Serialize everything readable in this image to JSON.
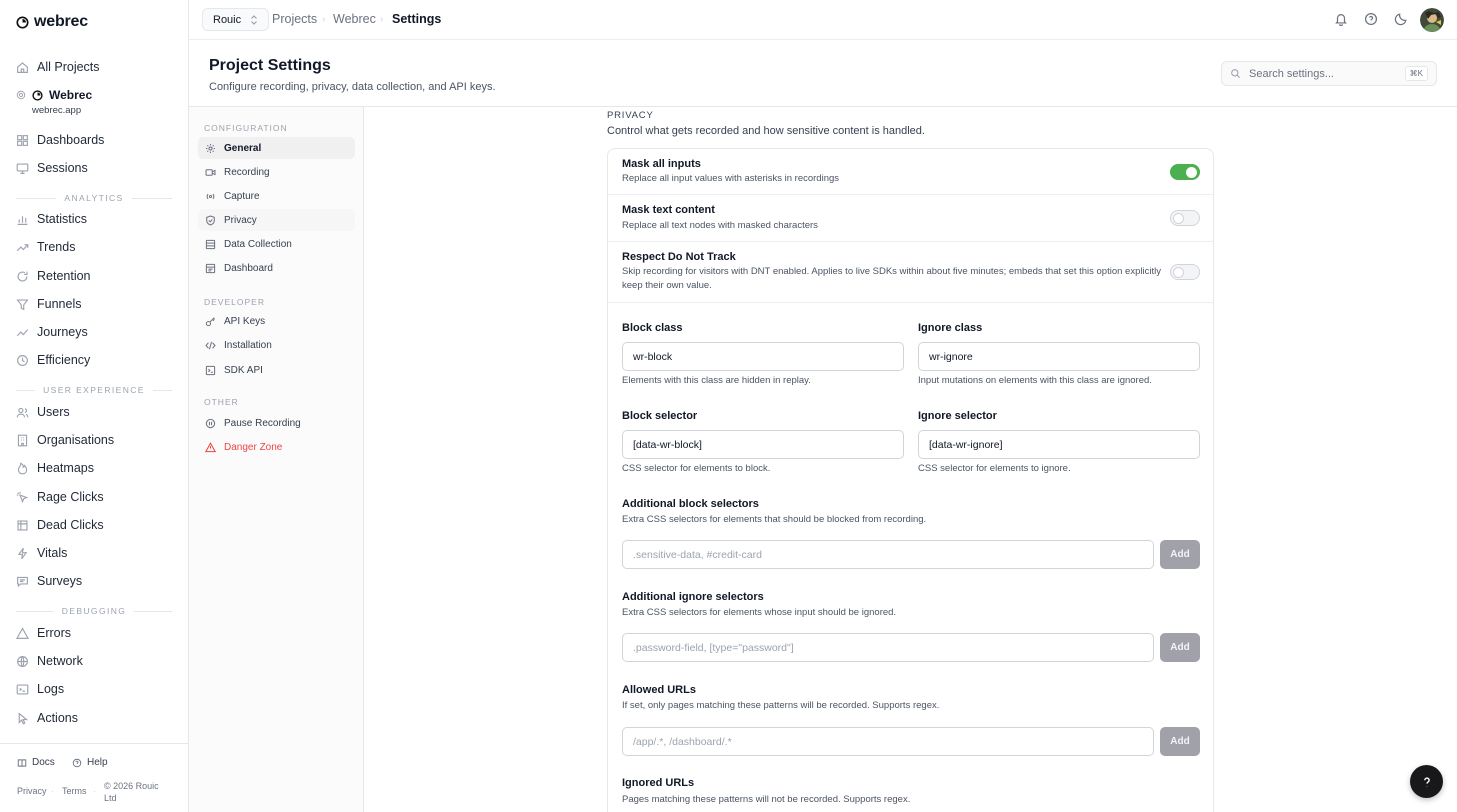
{
  "app": {
    "name": "webrec"
  },
  "sidebar": {
    "all_projects": "All Projects",
    "project": {
      "name": "Webrec",
      "domain": "webrec.app"
    },
    "top_items": [
      {
        "label": "Dashboards",
        "icon": "dashboard-icon"
      },
      {
        "label": "Sessions",
        "icon": "monitor-icon"
      }
    ],
    "sections": [
      {
        "label": "ANALYTICS",
        "items": [
          {
            "label": "Statistics",
            "icon": "bar-chart-icon"
          },
          {
            "label": "Trends",
            "icon": "trend-icon"
          },
          {
            "label": "Retention",
            "icon": "refresh-icon"
          },
          {
            "label": "Funnels",
            "icon": "funnel-icon"
          },
          {
            "label": "Journeys",
            "icon": "route-icon"
          },
          {
            "label": "Efficiency",
            "icon": "clock-icon"
          }
        ]
      },
      {
        "label": "USER EXPERIENCE",
        "items": [
          {
            "label": "Users",
            "icon": "users-icon"
          },
          {
            "label": "Organisations",
            "icon": "building-icon"
          },
          {
            "label": "Heatmaps",
            "icon": "flame-icon"
          },
          {
            "label": "Rage Clicks",
            "icon": "rage-click-icon"
          },
          {
            "label": "Dead Clicks",
            "icon": "dead-click-icon"
          },
          {
            "label": "Vitals",
            "icon": "activity-icon"
          },
          {
            "label": "Surveys",
            "icon": "message-icon"
          }
        ]
      },
      {
        "label": "DEBUGGING",
        "items": [
          {
            "label": "Errors",
            "icon": "warning-icon"
          },
          {
            "label": "Network",
            "icon": "globe-icon"
          },
          {
            "label": "Logs",
            "icon": "terminal-icon"
          },
          {
            "label": "Actions",
            "icon": "pointer-icon"
          }
        ]
      }
    ],
    "footer": {
      "docs": "Docs",
      "help": "Help",
      "privacy": "Privacy",
      "terms": "Terms",
      "copyright": "© 2026 Rouic Ltd"
    }
  },
  "topbar": {
    "org": "Rouic",
    "breadcrumbs": [
      "Projects",
      "Webrec",
      "Settings"
    ],
    "icons": [
      "bell-icon",
      "help-circle-icon",
      "moon-icon"
    ]
  },
  "header": {
    "title": "Project Settings",
    "subtitle": "Configure recording, privacy, data collection, and API keys.",
    "search_placeholder": "Search settings...",
    "search_shortcut": "⌘K"
  },
  "settings_nav": {
    "groups": [
      {
        "label": "CONFIGURATION",
        "items": [
          {
            "label": "General",
            "icon": "gear-icon",
            "active": true
          },
          {
            "label": "Recording",
            "icon": "video-icon"
          },
          {
            "label": "Capture",
            "icon": "broadcast-icon"
          },
          {
            "label": "Privacy",
            "icon": "shield-icon"
          },
          {
            "label": "Data Collection",
            "icon": "database-icon"
          },
          {
            "label": "Dashboard",
            "icon": "layout-icon"
          }
        ]
      },
      {
        "label": "DEVELOPER",
        "items": [
          {
            "label": "API Keys",
            "icon": "key-icon"
          },
          {
            "label": "Installation",
            "icon": "code-icon"
          },
          {
            "label": "SDK API",
            "icon": "terminal-square-icon"
          }
        ]
      },
      {
        "label": "OTHER",
        "items": [
          {
            "label": "Pause Recording",
            "icon": "pause-icon"
          },
          {
            "label": "Danger Zone",
            "icon": "alert-triangle-icon",
            "danger": true
          }
        ]
      }
    ]
  },
  "privacy": {
    "title": "PRIVACY",
    "description": "Control what gets recorded and how sensitive content is handled.",
    "toggles": [
      {
        "label": "Mask all inputs",
        "description": "Replace all input values with asterisks in recordings",
        "on": true
      },
      {
        "label": "Mask text content",
        "description": "Replace all text nodes with masked characters",
        "on": false
      },
      {
        "label": "Respect Do Not Track",
        "description": "Skip recording for visitors with DNT enabled. Applies to live SDKs within about five minutes; embeds that set this option explicitly keep their own value.",
        "on": false
      }
    ],
    "block_class": {
      "label": "Block class",
      "value": "wr-block",
      "help": "Elements with this class are hidden in replay."
    },
    "ignore_class": {
      "label": "Ignore class",
      "value": "wr-ignore",
      "help": "Input mutations on elements with this class are ignored."
    },
    "block_selector": {
      "label": "Block selector",
      "value": "[data-wr-block]",
      "help": "CSS selector for elements to block."
    },
    "ignore_selector": {
      "label": "Ignore selector",
      "value": "[data-wr-ignore]",
      "help": "CSS selector for elements to ignore."
    },
    "additional_block": {
      "label": "Additional block selectors",
      "description": "Extra CSS selectors for elements that should be blocked from recording.",
      "placeholder": ".sensitive-data, #credit-card",
      "button": "Add"
    },
    "additional_ignore": {
      "label": "Additional ignore selectors",
      "description": "Extra CSS selectors for elements whose input should be ignored.",
      "placeholder": ".password-field, [type=\"password\"]",
      "button": "Add"
    },
    "allowed_urls": {
      "label": "Allowed URLs",
      "description": "If set, only pages matching these patterns will be recorded. Supports regex.",
      "placeholder": "/app/.*, /dashboard/.*",
      "button": "Add"
    },
    "ignored_urls": {
      "label": "Ignored URLs",
      "description": "Pages matching these patterns will not be recorded. Supports regex."
    }
  },
  "colors": {
    "toggle_on": "#4caf50",
    "danger": "#ef4444",
    "add_button": "#a1a1aa"
  }
}
